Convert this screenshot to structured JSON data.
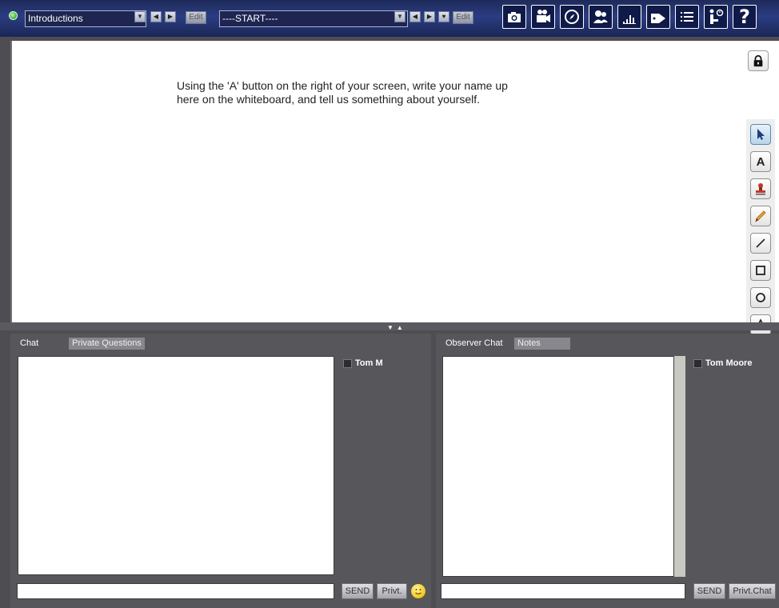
{
  "toolbar": {
    "agenda_select": "Introductions",
    "agenda_edit": "Edit",
    "slide_select": "----START----",
    "slide_edit": "Edit",
    "tools": [
      "camera-icon",
      "webcam-icon",
      "compass-icon",
      "users-icon",
      "poll-chart-icon",
      "tag-icon",
      "list-icon",
      "hand-raise-icon",
      "help-icon"
    ],
    "help_label": "?"
  },
  "whiteboard": {
    "text_line1": "Using the 'A' button on the right of your screen, write your name up",
    "text_line2": "here on the whiteboard, and tell us something about yourself.",
    "palette": [
      "pointer-icon",
      "text-icon",
      "stamp-icon",
      "pencil-icon",
      "line-icon",
      "rectangle-icon",
      "circle-icon",
      "triangle-icon"
    ],
    "text_tool_label": "A"
  },
  "left_panel": {
    "tab_chat": "Chat",
    "tab_private": "Private Questions",
    "user": "Tom M",
    "send": "SEND",
    "privt": "Privt."
  },
  "right_panel": {
    "tab_observer": "Observer Chat",
    "tab_notes": "Notes",
    "user": "Tom Moore",
    "send": "SEND",
    "privt_chat": "Privt.Chat"
  },
  "colors": {
    "toolbar_bg": "#2b3d82",
    "panel_bg": "#56565b",
    "board_bg": "#ffffff"
  }
}
